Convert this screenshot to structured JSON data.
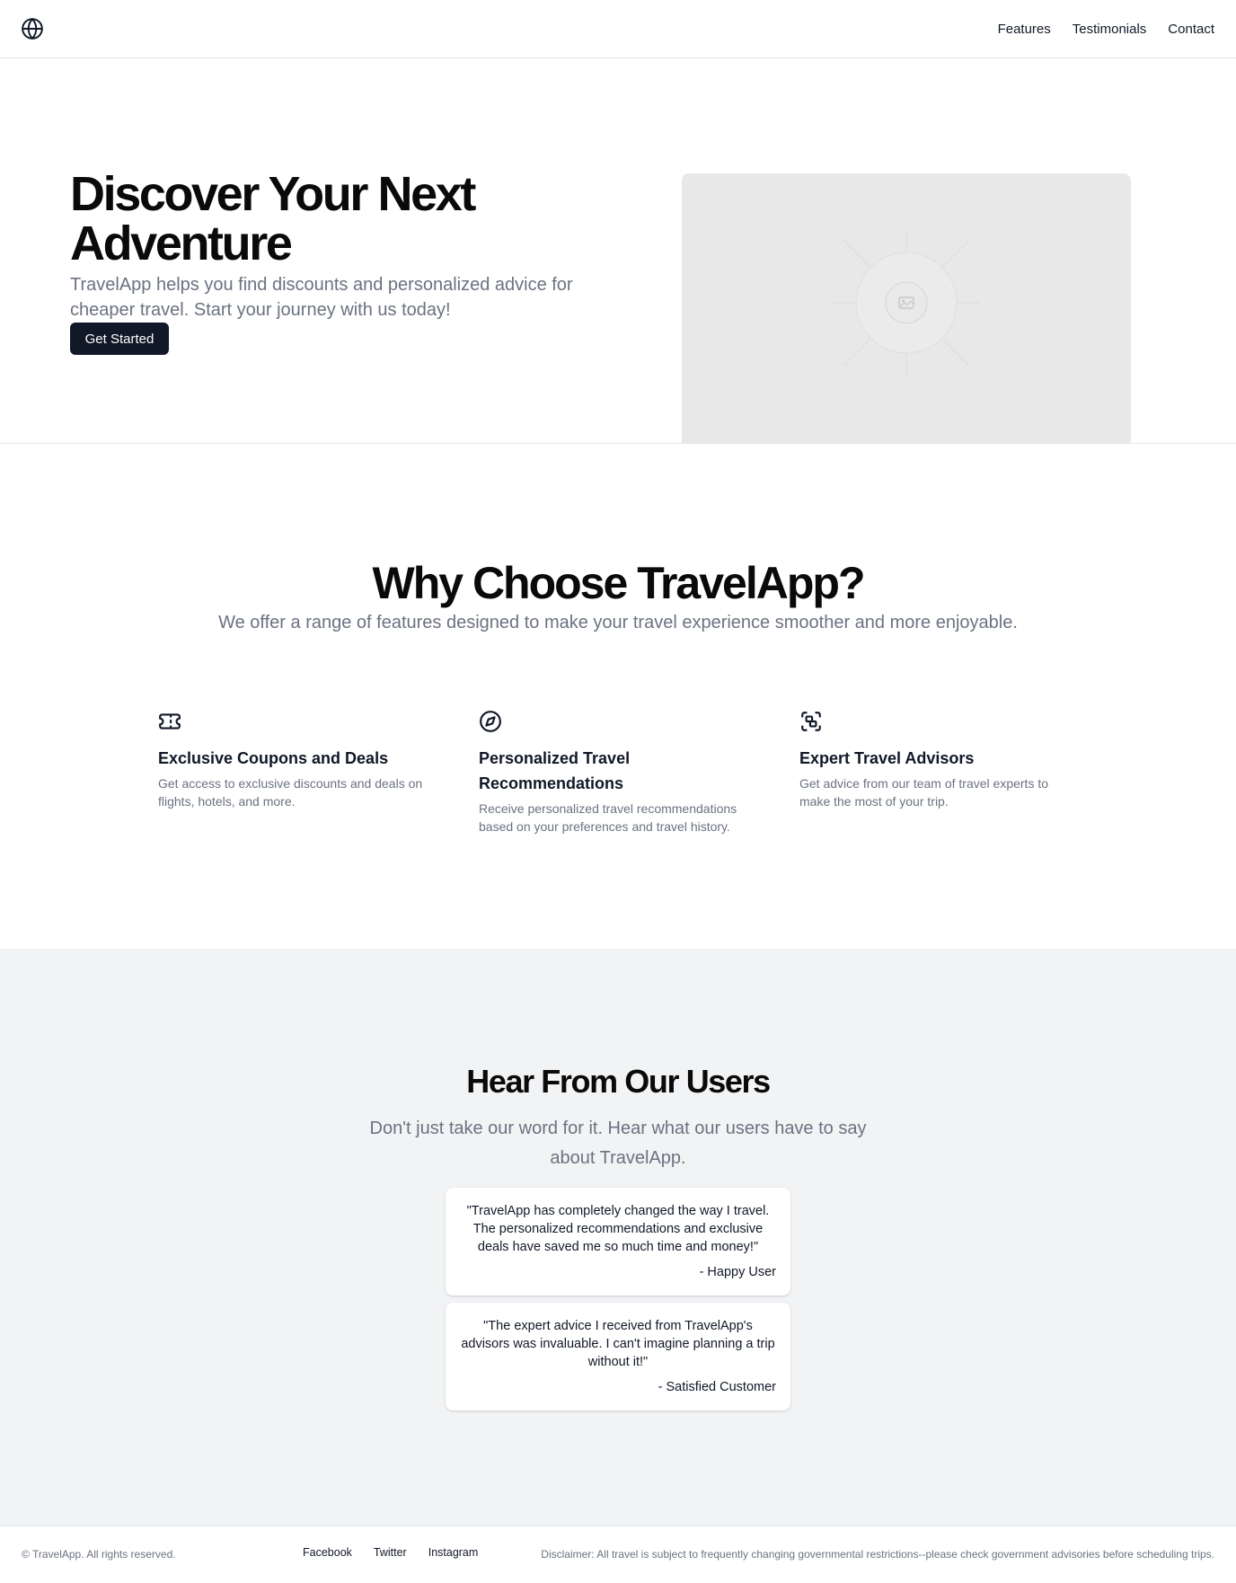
{
  "header": {
    "logo_icon": "globe-icon",
    "nav": [
      {
        "label": "Features"
      },
      {
        "label": "Testimonials"
      },
      {
        "label": "Contact"
      }
    ]
  },
  "hero": {
    "title": "Discover Your Next Adventure",
    "subtitle": "TravelApp helps you find discounts and personalized advice for cheaper travel. Start your journey with us today!",
    "cta_label": "Get Started",
    "image_icon": "image-placeholder-icon"
  },
  "features": {
    "title": "Why Choose TravelApp?",
    "subtitle": "We offer a range of features designed to make your travel experience smoother and more enjoyable.",
    "items": [
      {
        "icon": "ticket-icon",
        "title": "Exclusive Coupons and Deals",
        "description": "Get access to exclusive discounts and deals on flights, hotels, and more."
      },
      {
        "icon": "compass-icon",
        "title": "Personalized Travel Recommendations",
        "description": "Receive personalized travel recommendations based on your preferences and travel history."
      },
      {
        "icon": "advisor-scan-icon",
        "title": "Expert Travel Advisors",
        "description": "Get advice from our team of travel experts to make the most of your trip."
      }
    ]
  },
  "testimonials": {
    "title": "Hear From Our Users",
    "subtitle": "Don't just take our word for it. Hear what our users have to say about TravelApp.",
    "items": [
      {
        "quote": "\"TravelApp has completely changed the way I travel. The personalized recommendations and exclusive deals have saved me so much time and money!\"",
        "author": "- Happy User"
      },
      {
        "quote": "\"The expert advice I received from TravelApp's advisors was invaluable. I can't imagine planning a trip without it!\"",
        "author": "- Satisfied Customer"
      }
    ]
  },
  "footer": {
    "copyright": "© TravelApp. All rights reserved.",
    "links": [
      {
        "label": "Facebook"
      },
      {
        "label": "Twitter"
      },
      {
        "label": "Instagram"
      }
    ],
    "disclaimer": "Disclaimer: All travel is subject to frequently changing governmental restrictions--please check government advisories before scheduling trips."
  },
  "colors": {
    "primary_button": "#111827",
    "muted_text": "#6b7280",
    "section_alt_bg": "#f2f3f5",
    "image_placeholder_bg": "#e8e8e8"
  }
}
